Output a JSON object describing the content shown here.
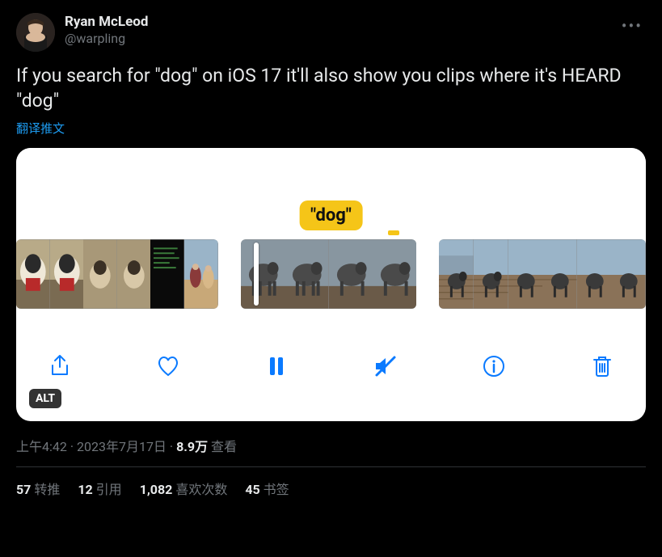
{
  "user": {
    "display_name": "Ryan McLeod",
    "handle": "@warpling"
  },
  "tweet_text": "If you search for \"dog\" on iOS 17 it'll also show you clips where it's HEARD \"dog\"",
  "translate_label": "翻译推文",
  "media": {
    "caption_text": "\"dog\"",
    "alt_badge": "ALT"
  },
  "meta": {
    "time": "上午4:42",
    "sep": " · ",
    "date": "2023年7月17日",
    "views_num": "8.9万",
    "views_label": " 查看"
  },
  "stats": {
    "retweets_num": "57",
    "retweets_label": " 转推",
    "quotes_num": "12",
    "quotes_label": " 引用",
    "likes_num": "1,082",
    "likes_label": " 喜欢次数",
    "bookmarks_num": "45",
    "bookmarks_label": " 书签"
  }
}
